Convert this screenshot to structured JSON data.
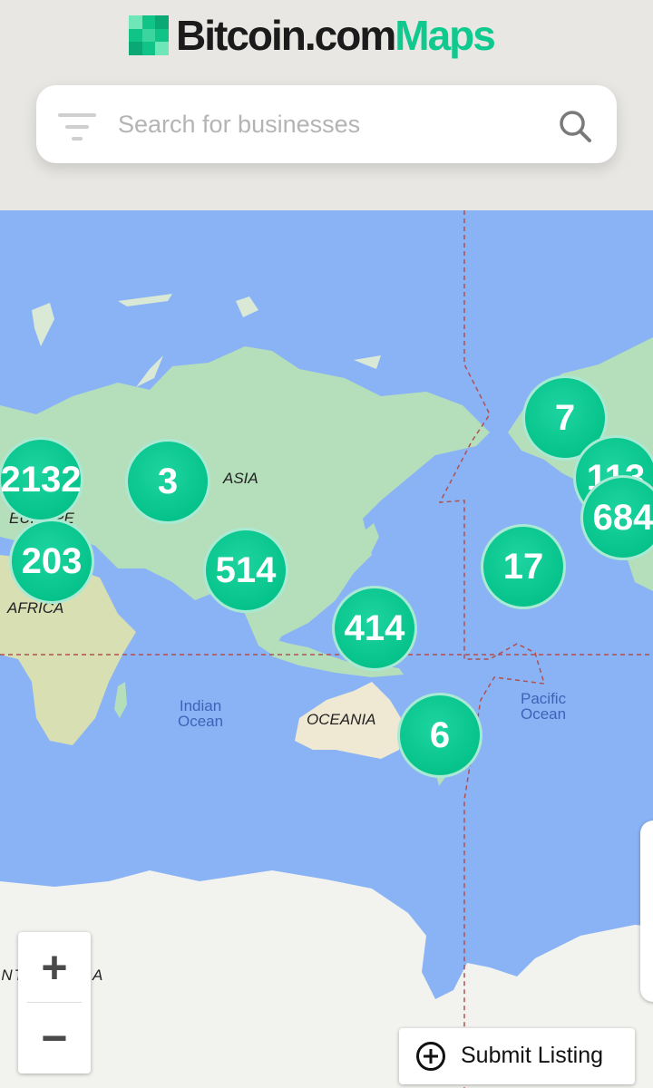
{
  "header": {
    "logo_part1": "Bitcoin.com",
    "logo_part2": "Maps"
  },
  "search": {
    "placeholder": "Search for businesses"
  },
  "map": {
    "labels": {
      "asia": "ASIA",
      "europe": "EUROPE",
      "africa": "AFRICA",
      "oceania": "OCEANIA",
      "antarctica": "ANTARCTICA",
      "indian_ocean": "Indian\nOcean",
      "pacific_ocean": "Pacific\nOcean"
    },
    "clusters": [
      {
        "id": "europe-north",
        "count": "2132"
      },
      {
        "id": "russia",
        "count": "3"
      },
      {
        "id": "africa-north",
        "count": "203"
      },
      {
        "id": "south-asia",
        "count": "514"
      },
      {
        "id": "southeast-asia",
        "count": "414"
      },
      {
        "id": "australia-east",
        "count": "6"
      },
      {
        "id": "pacific",
        "count": "17"
      },
      {
        "id": "alaska",
        "count": "7"
      },
      {
        "id": "canada-west",
        "count": "113"
      },
      {
        "id": "us-west",
        "count": "684"
      }
    ]
  },
  "controls": {
    "zoom_in": "+",
    "zoom_out": "−",
    "submit_label": "Submit Listing"
  },
  "colors": {
    "brand_green": "#10c98e",
    "ocean": "#8ab3f5",
    "land": "#a8dbb2",
    "cluster": "#06c38b"
  }
}
